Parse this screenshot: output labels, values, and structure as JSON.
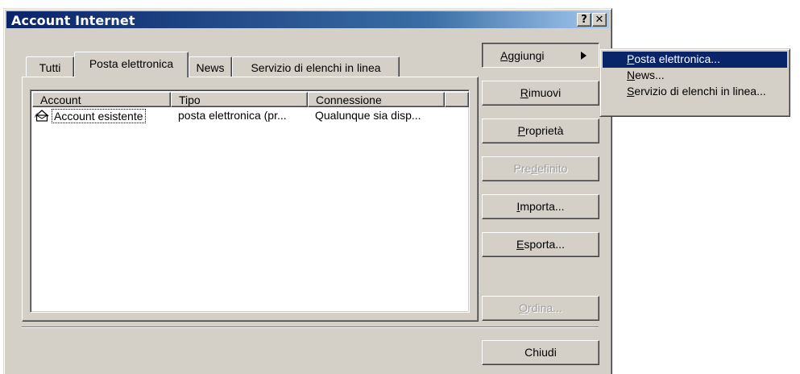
{
  "window": {
    "title": "Account Internet",
    "help_glyph": "?",
    "close_glyph": "✕"
  },
  "tabs": [
    {
      "label": "Tutti",
      "active": false
    },
    {
      "label": "Posta elettronica",
      "active": true
    },
    {
      "label": "News",
      "active": false
    },
    {
      "label": "Servizio di elenchi in linea",
      "active": false
    }
  ],
  "list": {
    "columns": [
      "Account",
      "Tipo",
      "Connessione",
      ""
    ],
    "rows": [
      {
        "account": "Account esistente",
        "tipo": "posta elettronica (pr...",
        "connessione": "Qualunque sia disp...",
        "icon": "mail-account-icon"
      }
    ]
  },
  "buttons": {
    "aggiungi": {
      "first": "A",
      "rest": "ggiungi",
      "state": "pressed"
    },
    "rimuovi": {
      "first": "R",
      "rest": "imuovi",
      "state": "normal"
    },
    "proprieta": {
      "first": "P",
      "rest": "roprietà",
      "state": "normal"
    },
    "predefinito": {
      "pre": "Pre",
      "key": "d",
      "rest": "efinito",
      "state": "disabled"
    },
    "importa": {
      "first": "I",
      "rest": "mporta...",
      "state": "normal"
    },
    "esporta": {
      "first": "E",
      "rest": "sporta...",
      "state": "normal"
    },
    "ordina": {
      "first": "O",
      "rest": "rdina...",
      "state": "disabled"
    },
    "chiudi": {
      "label": "Chiudi",
      "state": "normal"
    }
  },
  "submenu": [
    {
      "first": "P",
      "rest": "osta elettronica...",
      "selected": true
    },
    {
      "first": "N",
      "rest": "ews...",
      "selected": false
    },
    {
      "first": "S",
      "rest": "ervizio di elenchi in linea...",
      "selected": false
    }
  ],
  "colors": {
    "title_bar_start": "#0a246a",
    "title_bar_end": "#a6caf0",
    "face": "#d4d0c8",
    "selection": "#0a246a",
    "disabled_text": "#a0a0a0"
  }
}
